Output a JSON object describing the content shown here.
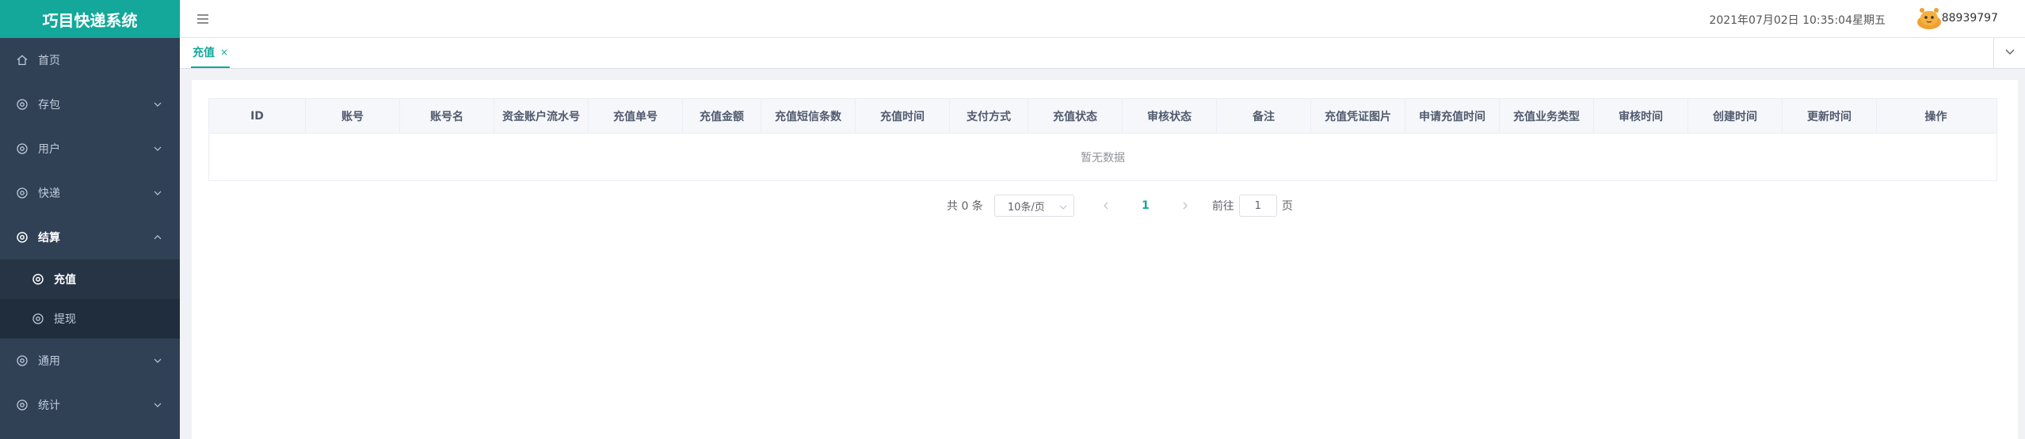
{
  "app": {
    "title": "巧目快递系统"
  },
  "sidebar": {
    "items": [
      {
        "label": "首页",
        "icon": "home-icon",
        "expandable": false
      },
      {
        "label": "存包",
        "icon": "gear-icon",
        "expandable": true
      },
      {
        "label": "用户",
        "icon": "gear-icon",
        "expandable": true
      },
      {
        "label": "快递",
        "icon": "gear-icon",
        "expandable": true
      },
      {
        "label": "结算",
        "icon": "gear-icon",
        "expandable": true,
        "expanded": true
      },
      {
        "label": "通用",
        "icon": "gear-icon",
        "expandable": true
      },
      {
        "label": "统计",
        "icon": "gear-icon",
        "expandable": true
      }
    ],
    "settlement_sub": [
      {
        "label": "充值",
        "active": true
      },
      {
        "label": "提现",
        "active": false
      }
    ]
  },
  "header": {
    "datetime": "2021年07月02日 10:35:04星期五",
    "username": "88939797"
  },
  "tabs": [
    {
      "label": "充值",
      "close": "×"
    }
  ],
  "table": {
    "columns": [
      "ID",
      "账号",
      "账号名",
      "资金账户流水号",
      "充值单号",
      "充值金额",
      "充值短信条数",
      "充值时间",
      "支付方式",
      "充值状态",
      "审核状态",
      "备注",
      "充值凭证图片",
      "申请充值时间",
      "充值业务类型",
      "审核时间",
      "创建时间",
      "更新时间",
      "操作"
    ],
    "empty_text": "暂无数据"
  },
  "pagination": {
    "total_text": "共 0 条",
    "page_size": "10条/页",
    "current_page": "1",
    "goto_label": "前往",
    "goto_value": "1",
    "page_suffix": "页"
  },
  "colors": {
    "brand": "#13a89a",
    "sidebar_bg": "#304156",
    "submenu_bg": "#1f2d3d"
  }
}
